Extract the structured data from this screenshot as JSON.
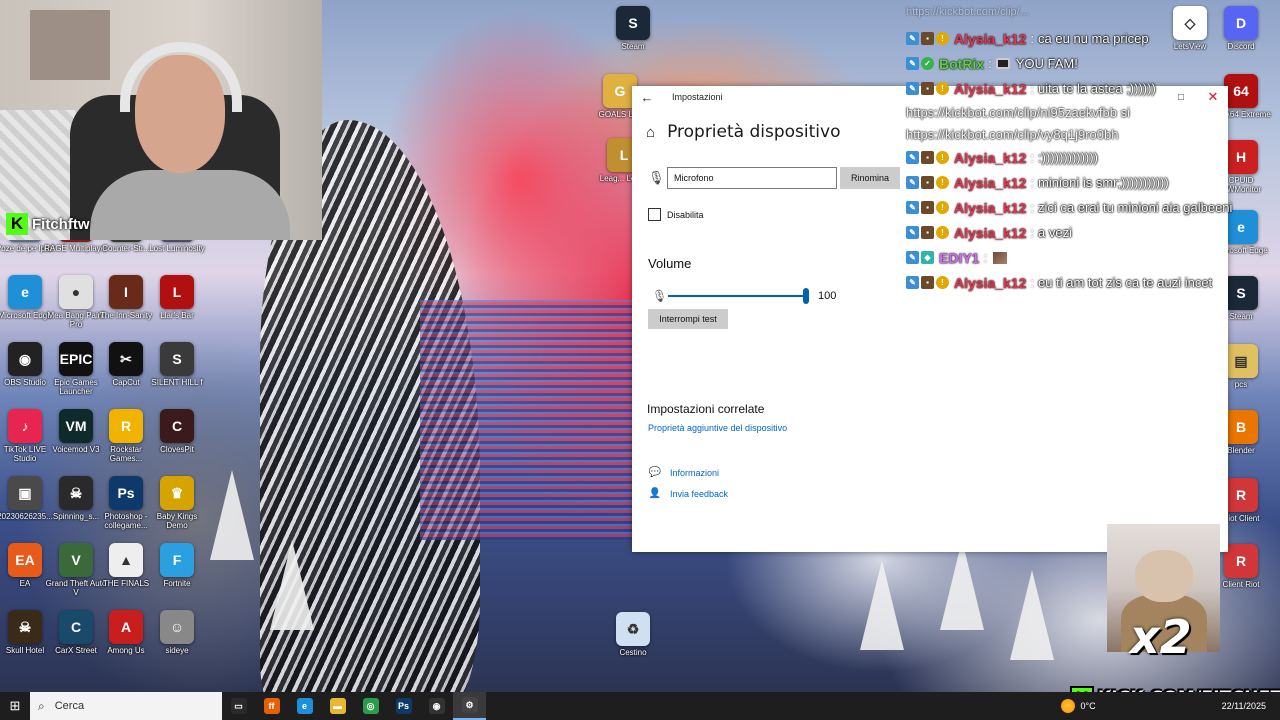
{
  "webcam": {
    "streamer_name": "Fitchftw"
  },
  "desktop_icons_left": [
    {
      "label": "Poze de pe Ipad",
      "color": "#5a6e82",
      "glyph": "▦"
    },
    {
      "label": "RAGE Multiplayer",
      "color": "#8a1a1a",
      "glyph": "R"
    },
    {
      "label": "Counter-Str...",
      "color": "#2f3b2f",
      "glyph": "CS"
    },
    {
      "label": "Lost Luminosity",
      "color": "#4a4a6a",
      "glyph": "L"
    },
    {
      "label": "Microsoft Edge",
      "color": "#1f8fd8",
      "glyph": "e"
    },
    {
      "label": "Mea Bang Paint Pro",
      "color": "#e0e0e0",
      "glyph": "●"
    },
    {
      "label": "The Inn-Sanity",
      "color": "#6a2a1a",
      "glyph": "I"
    },
    {
      "label": "Liar's Bar",
      "color": "#b01010",
      "glyph": "L"
    },
    {
      "label": "OBS Studio",
      "color": "#222222",
      "glyph": "◉"
    },
    {
      "label": "Epic Games Launcher",
      "color": "#111111",
      "glyph": "EPIC"
    },
    {
      "label": "CapCut",
      "color": "#111111",
      "glyph": "✂"
    },
    {
      "label": "SILENT HILL f",
      "color": "#3a3a3a",
      "glyph": "S"
    },
    {
      "label": "TikTok LIVE Studio",
      "color": "#e8254f",
      "glyph": "♪"
    },
    {
      "label": "Voicemod V3",
      "color": "#0f2a2a",
      "glyph": "VM"
    },
    {
      "label": "Rockstar Games...",
      "color": "#f0b400",
      "glyph": "R"
    },
    {
      "label": "ClovesPit",
      "color": "#3a1a1a",
      "glyph": "C"
    },
    {
      "label": "20230626235...",
      "color": "#4a4a4a",
      "glyph": "▣"
    },
    {
      "label": "Spinning_s...",
      "color": "#2a2a2a",
      "glyph": "☠"
    },
    {
      "label": "Photoshop - collegame...",
      "color": "#0e3a6b",
      "glyph": "Ps"
    },
    {
      "label": "Baby Kings Demo",
      "color": "#d6a400",
      "glyph": "♛"
    },
    {
      "label": "EA",
      "color": "#e85a1a",
      "glyph": "EA"
    },
    {
      "label": "Grand Theft Auto V",
      "color": "#3a6a3a",
      "glyph": "V"
    },
    {
      "label": "THE FINALS",
      "color": "#eeeeee",
      "glyph": "▲"
    },
    {
      "label": "Fortnite",
      "color": "#2aa0e0",
      "glyph": "F"
    },
    {
      "label": "Skull Hotel",
      "color": "#3a2a1a",
      "glyph": "☠"
    },
    {
      "label": "CarX Street",
      "color": "#1a4a6a",
      "glyph": "C"
    },
    {
      "label": "Among Us",
      "color": "#c81e1e",
      "glyph": "A"
    },
    {
      "label": "sideye",
      "color": "#888888",
      "glyph": "☺"
    }
  ],
  "desktop_icons_center": [
    {
      "label": "Steam",
      "color": "#1b2838",
      "glyph": "S"
    },
    {
      "label": "GOALS Li...",
      "color": "#e0b040",
      "glyph": "G"
    },
    {
      "label": "Leag... Legi...",
      "color": "#c09030",
      "glyph": "L"
    },
    {
      "label": "Cestino",
      "color": "#d0e0f0",
      "glyph": "♻"
    }
  ],
  "desktop_icons_right": [
    {
      "label": "LetsView",
      "color": "#ffffff",
      "glyph": "◇"
    },
    {
      "label": "Discord",
      "color": "#5865f2",
      "glyph": "D"
    },
    {
      "label": "AIDA64 Extreme",
      "color": "#b01010",
      "glyph": "64"
    },
    {
      "label": "CPUID HWMonitor",
      "color": "#cc2020",
      "glyph": "H"
    },
    {
      "label": "Microsoft Edge",
      "color": "#1f8fd8",
      "glyph": "e"
    },
    {
      "label": "Steam",
      "color": "#1b2838",
      "glyph": "S"
    },
    {
      "label": "pcs",
      "color": "#e0c060",
      "glyph": "▤"
    },
    {
      "label": "Blender",
      "color": "#ea7600",
      "glyph": "B"
    },
    {
      "label": "Riot Client",
      "color": "#d13639",
      "glyph": "R"
    },
    {
      "label": "Client Riot",
      "color": "#d13639",
      "glyph": "R"
    }
  ],
  "settings": {
    "window_title": "Impostazioni",
    "back_glyph": "←",
    "max_glyph": "□",
    "close_glyph": "✕",
    "home_glyph": "⌂",
    "page_title": "Proprietà dispositivo",
    "mic_glyph": "🎙",
    "device_name_value": "Microfono",
    "rename_label": "Rinomina",
    "disable_label": "Disabilita",
    "disable_checked": false,
    "volume_title": "Volume",
    "volume_value": 100,
    "volume_display": "100",
    "stop_test_label": "Interrompi test",
    "related_title": "Impostazioni correlate",
    "related_link": "Proprietà aggiuntive del dispositivo",
    "info_glyph": "💬",
    "info_link": "Informazioni",
    "feedback_glyph": "👤",
    "feedback_link": "Invia feedback"
  },
  "chat": {
    "top_faded_text": "https://kickbot.com/clip/...",
    "messages": [
      {
        "user": "Alysia_k12",
        "color": "#e8344f",
        "badges": [
          "mod",
          "sub",
          "coin"
        ],
        "text": "ca eu nu ma pricep"
      },
      {
        "user": "BotRix",
        "color": "#58d33a",
        "badges": [
          "mod",
          "bot"
        ],
        "text": "YOU FAM!",
        "emote_before": true
      },
      {
        "user": "Alysia_k12",
        "color": "#e8344f",
        "badges": [
          "mod",
          "sub",
          "coin"
        ],
        "text": "uita te la astea ;))))))"
      },
      {
        "url": "https://kickbot.com/clip/ni95zaekvfbb si"
      },
      {
        "url": "https://kickbot.com/clip/vy8q1j9ro0bh"
      },
      {
        "user": "Alysia_k12",
        "color": "#e8344f",
        "badges": [
          "mod",
          "sub",
          "coin"
        ],
        "text": ":)))))))))))))"
      },
      {
        "user": "Alysia_k12",
        "color": "#e8344f",
        "badges": [
          "mod",
          "sub",
          "coin"
        ],
        "text": "minioni is smr;)))))))))))"
      },
      {
        "user": "Alysia_k12",
        "color": "#e8344f",
        "badges": [
          "mod",
          "sub",
          "coin"
        ],
        "text": "zici ca erai tu minioni aia galbeeni"
      },
      {
        "user": "Alysia_k12",
        "color": "#e8344f",
        "badges": [
          "mod",
          "sub",
          "coin"
        ],
        "text": "a vezi"
      },
      {
        "user": "EDIY1",
        "color": "#d06cf0",
        "badges": [
          "mod",
          "vip"
        ],
        "text": "",
        "emote_after": true
      },
      {
        "user": "Alysia_k12",
        "color": "#e8344f",
        "badges": [
          "mod",
          "sub",
          "coin"
        ],
        "text": "eu ti am tot zis ca te auzi incet"
      }
    ]
  },
  "cat_overlay": {
    "multiplier": "x2"
  },
  "kick_banner": {
    "logo": "K",
    "text": "KICK.COM/FITCHFTW"
  },
  "taskbar": {
    "start_glyph": "⊞",
    "search_glyph": "⌕",
    "search_placeholder": "Cerca",
    "apps": [
      {
        "name": "task-view",
        "color": "#2a2a2a",
        "glyph": "▭"
      },
      {
        "name": "firefox",
        "color": "#e66000",
        "glyph": "ff"
      },
      {
        "name": "edge",
        "color": "#1f8fd8",
        "glyph": "e"
      },
      {
        "name": "file-explorer",
        "color": "#e8b830",
        "glyph": "▬"
      },
      {
        "name": "chrome",
        "color": "#2a9d4a",
        "glyph": "◎"
      },
      {
        "name": "photoshop",
        "color": "#0e3a6b",
        "glyph": "Ps"
      },
      {
        "name": "obs",
        "color": "#333333",
        "glyph": "◉"
      },
      {
        "name": "settings",
        "color": "#444444",
        "glyph": "⚙",
        "active": true
      }
    ],
    "temperature": "0°C",
    "date": "22/11/2025"
  }
}
